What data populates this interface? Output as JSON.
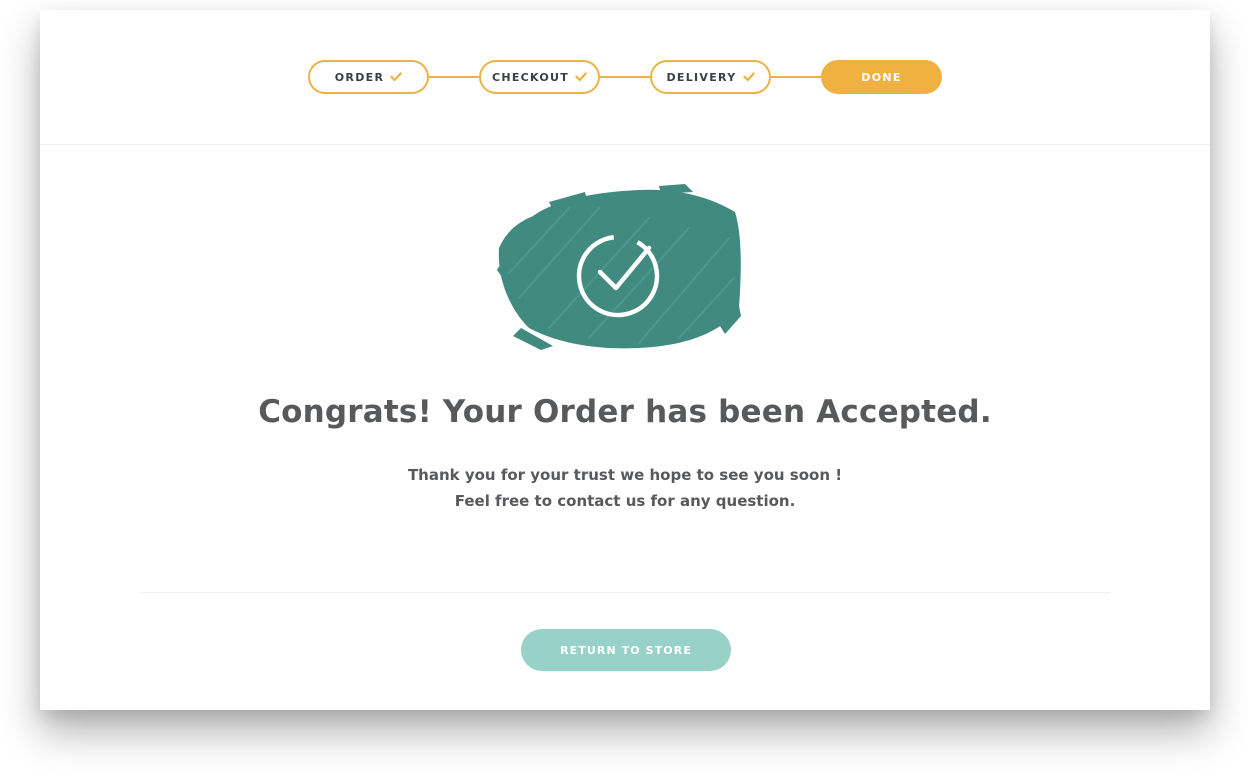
{
  "steps": [
    {
      "label": "ORDER",
      "completed": true
    },
    {
      "label": "CHECKOUT",
      "completed": true
    },
    {
      "label": "DELIVERY",
      "completed": true
    },
    {
      "label": "DONE",
      "completed": false,
      "active": true
    }
  ],
  "confirmation": {
    "icon": "check-circle-icon",
    "title": "Congrats! Your Order has been Accepted.",
    "line1": "Thank you for your trust we hope to see you soon !",
    "line2": "Feel free to contact us for any question."
  },
  "actions": {
    "return_label": "RETURN TO STORE"
  },
  "colors": {
    "accent": "#eeb142",
    "success": "#418a80",
    "button": "#98d1c8",
    "text": "#58595b"
  }
}
